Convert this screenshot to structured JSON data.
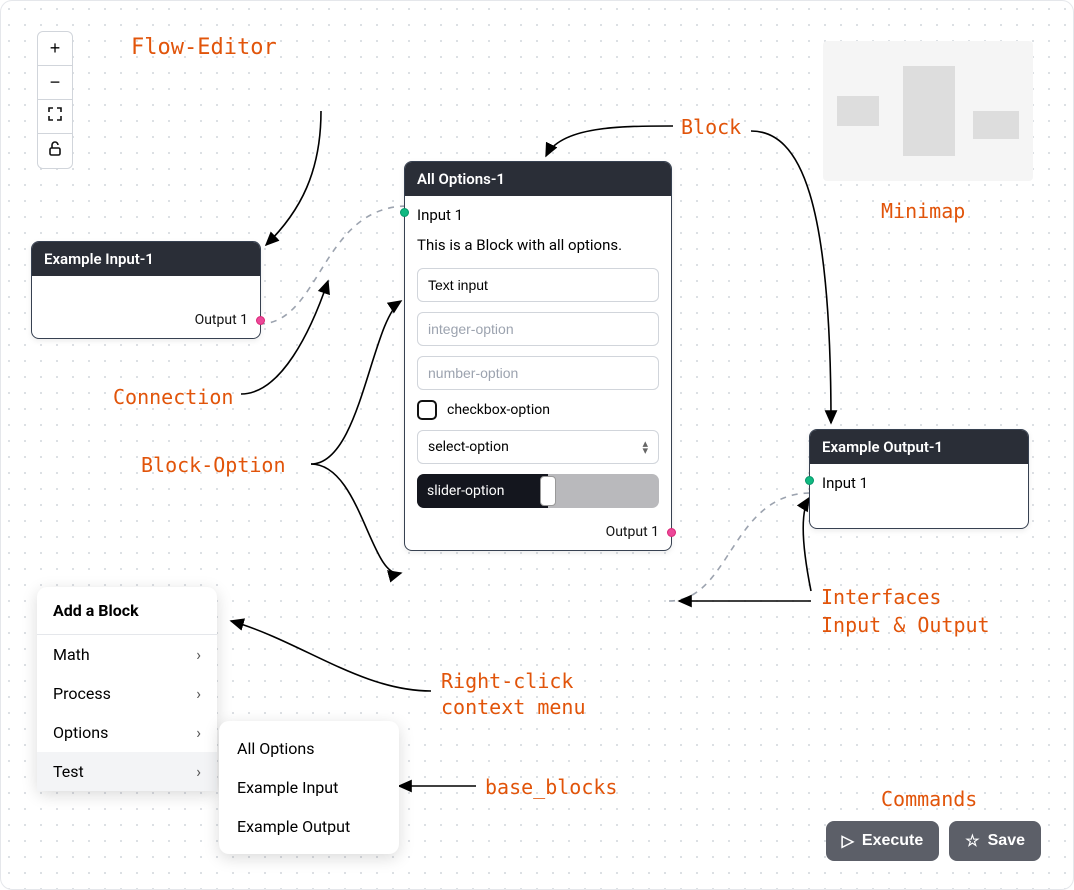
{
  "annotations": {
    "flow_editor": "Flow-Editor",
    "block": "Block",
    "minimap": "Minimap",
    "connection": "Connection",
    "block_option": "Block-Option",
    "context_menu_l1": "Right-click",
    "context_menu_l2": "context menu",
    "base_blocks": "base_blocks",
    "interfaces_l1": "Interfaces",
    "interfaces_l2": "Input & Output",
    "commands": "Commands"
  },
  "toolbar": {
    "zoom_in": "+",
    "zoom_out": "−",
    "fit": "fit-screen",
    "lock": "unlock"
  },
  "blocks": {
    "input1": {
      "title": "Example Input-1",
      "output_label": "Output 1"
    },
    "all_options": {
      "title": "All Options-1",
      "input_label": "Input 1",
      "description": "This is a Block with all options.",
      "text_value": "Text input",
      "integer_placeholder": "integer-option",
      "number_placeholder": "number-option",
      "checkbox_label": "checkbox-option",
      "select_value": "select-option",
      "slider_label": "slider-option",
      "output_label": "Output 1"
    },
    "output1": {
      "title": "Example Output-1",
      "input_label": "Input 1"
    }
  },
  "context_menu": {
    "title": "Add a Block",
    "categories": [
      "Math",
      "Process",
      "Options",
      "Test"
    ],
    "submenu": [
      "All Options",
      "Example Input",
      "Example Output"
    ]
  },
  "commands": {
    "execute": "Execute",
    "save": "Save"
  }
}
